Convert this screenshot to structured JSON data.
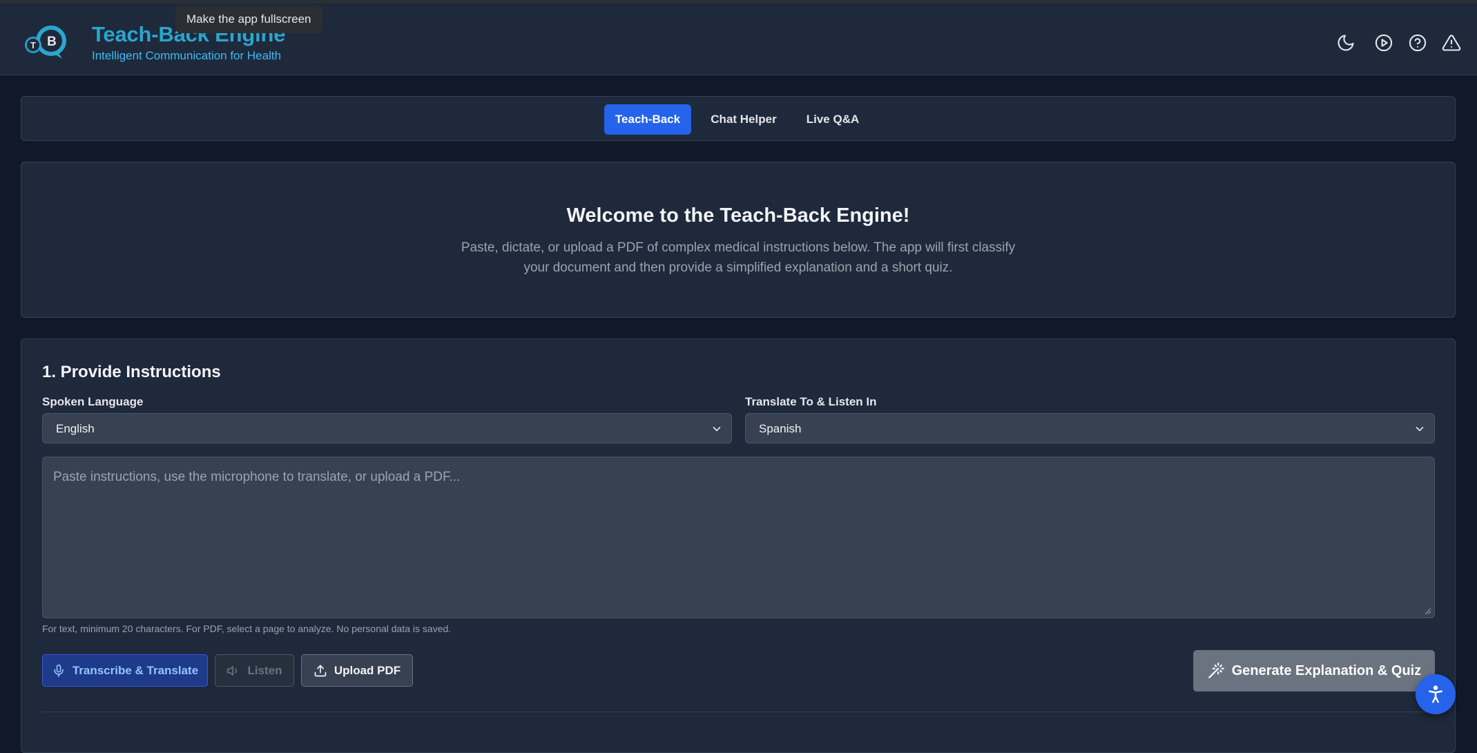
{
  "app": {
    "title": "Teach-Back Engine",
    "subtitle": "Intelligent Communication for Health",
    "logo_letters": [
      "T",
      "B"
    ]
  },
  "tooltip": "Make the app fullscreen",
  "header_icons": [
    "moon-icon",
    "play-circle-icon",
    "help-circle-icon",
    "alert-triangle-icon"
  ],
  "tabs": [
    {
      "label": "Teach-Back",
      "active": true
    },
    {
      "label": "Chat Helper",
      "active": false
    },
    {
      "label": "Live Q&A",
      "active": false
    }
  ],
  "welcome": {
    "title": "Welcome to the Teach-Back Engine!",
    "description": "Paste, dictate, or upload a PDF of complex medical instructions below. The app will first classify your document and then provide a simplified explanation and a short quiz."
  },
  "instructions": {
    "section_title": "1. Provide Instructions",
    "spoken_language_label": "Spoken Language",
    "spoken_language_value": "English",
    "translate_label": "Translate To & Listen In",
    "translate_value": "Spanish",
    "textarea_placeholder": "Paste instructions, use the microphone to translate, or upload a PDF...",
    "textarea_value": "",
    "hint": "For text, minimum 20 characters. For PDF, select a page to analyze. No personal data is saved."
  },
  "buttons": {
    "transcribe": "Transcribe & Translate",
    "listen": "Listen",
    "upload": "Upload PDF",
    "generate": "Generate Explanation & Quiz"
  },
  "colors": {
    "accent": "#2563eb",
    "brand": "#2aa6cf",
    "background": "#111827",
    "card": "#1e293b"
  }
}
